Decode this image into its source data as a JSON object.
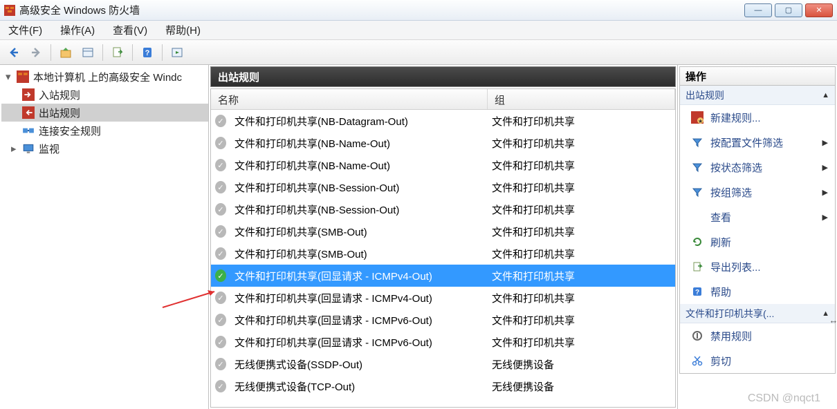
{
  "window": {
    "title": "高级安全 Windows 防火墙"
  },
  "menu": {
    "file": "文件(F)",
    "action": "操作(A)",
    "view": "查看(V)",
    "help": "帮助(H)"
  },
  "tree": {
    "root": "本地计算机 上的高级安全 Windc",
    "inbound": "入站规则",
    "outbound": "出站规则",
    "connsec": "连接安全规则",
    "monitor": "监视"
  },
  "center": {
    "title": "出站规则",
    "col_name": "名称",
    "col_group": "组"
  },
  "rules": [
    {
      "name": "文件和打印机共享(NB-Datagram-Out)",
      "group": "文件和打印机共享",
      "enabled": false,
      "selected": false
    },
    {
      "name": "文件和打印机共享(NB-Name-Out)",
      "group": "文件和打印机共享",
      "enabled": false,
      "selected": false
    },
    {
      "name": "文件和打印机共享(NB-Name-Out)",
      "group": "文件和打印机共享",
      "enabled": false,
      "selected": false
    },
    {
      "name": "文件和打印机共享(NB-Session-Out)",
      "group": "文件和打印机共享",
      "enabled": false,
      "selected": false
    },
    {
      "name": "文件和打印机共享(NB-Session-Out)",
      "group": "文件和打印机共享",
      "enabled": false,
      "selected": false
    },
    {
      "name": "文件和打印机共享(SMB-Out)",
      "group": "文件和打印机共享",
      "enabled": false,
      "selected": false
    },
    {
      "name": "文件和打印机共享(SMB-Out)",
      "group": "文件和打印机共享",
      "enabled": false,
      "selected": false
    },
    {
      "name": "文件和打印机共享(回显请求 - ICMPv4-Out)",
      "group": "文件和打印机共享",
      "enabled": true,
      "selected": true
    },
    {
      "name": "文件和打印机共享(回显请求 - ICMPv4-Out)",
      "group": "文件和打印机共享",
      "enabled": false,
      "selected": false
    },
    {
      "name": "文件和打印机共享(回显请求 - ICMPv6-Out)",
      "group": "文件和打印机共享",
      "enabled": false,
      "selected": false
    },
    {
      "name": "文件和打印机共享(回显请求 - ICMPv6-Out)",
      "group": "文件和打印机共享",
      "enabled": false,
      "selected": false
    },
    {
      "name": "无线便携式设备(SSDP-Out)",
      "group": "无线便携设备",
      "enabled": false,
      "selected": false
    },
    {
      "name": "无线便携式设备(TCP-Out)",
      "group": "无线便携设备",
      "enabled": false,
      "selected": false
    }
  ],
  "actions": {
    "panel_title": "操作",
    "section1_title": "出站规则",
    "new_rule": "新建规则...",
    "filter_profile": "按配置文件筛选",
    "filter_state": "按状态筛选",
    "filter_group": "按组筛选",
    "view": "查看",
    "refresh": "刷新",
    "export": "导出列表...",
    "help": "帮助",
    "section2_title": "文件和打印机共享(...",
    "disable_rule": "禁用规则",
    "cut": "剪切"
  },
  "watermark": "CSDN @nqct1"
}
